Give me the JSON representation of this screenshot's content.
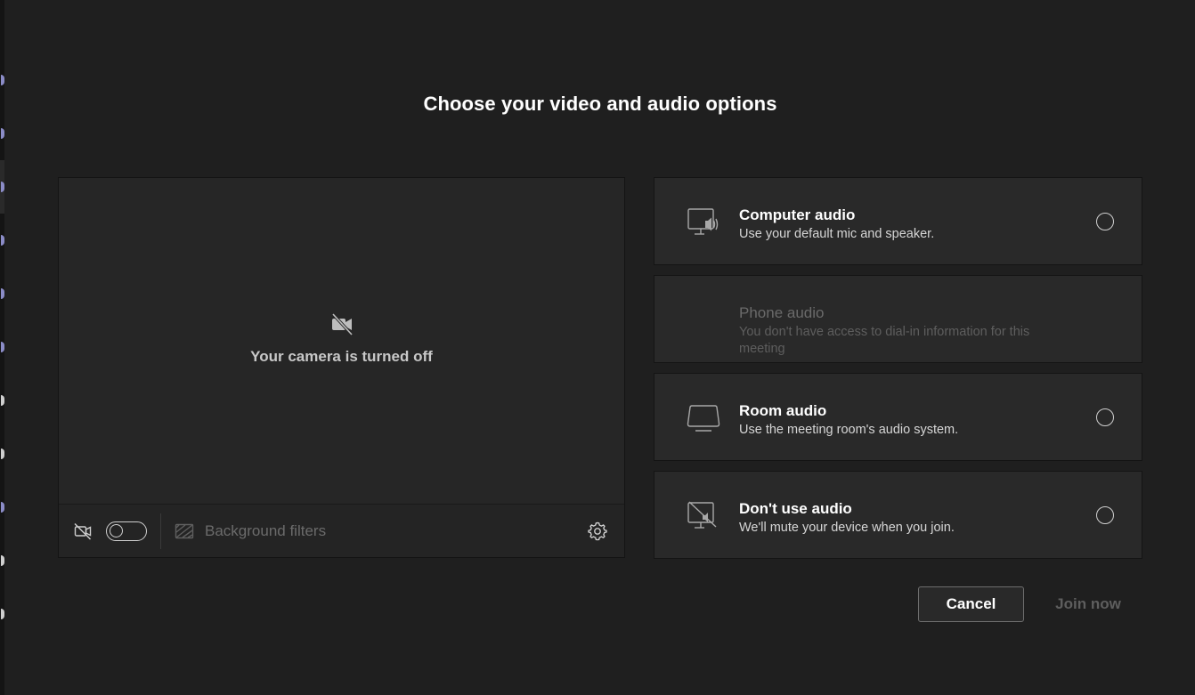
{
  "dialog": {
    "title": "Choose your video and audio options"
  },
  "preview": {
    "camera_off_text": "Your camera is turned off",
    "camera_toggle_state": "off",
    "background_filters_label": "Background filters",
    "icons": {
      "camera_off": "camera-off-icon",
      "background_filters": "background-filters-icon",
      "settings": "gear-icon"
    }
  },
  "audio_options": [
    {
      "title": "Computer audio",
      "description": "Use your default mic and speaker.",
      "icon": "computer-audio-icon",
      "enabled": true,
      "selected": false
    },
    {
      "title": "Phone audio",
      "description": "You don't have access to dial-in information for this meeting",
      "icon": "",
      "enabled": false,
      "selected": false
    },
    {
      "title": "Room audio",
      "description": "Use the meeting room's audio system.",
      "icon": "room-audio-icon",
      "enabled": true,
      "selected": false
    },
    {
      "title": "Don't use audio",
      "description": "We'll mute your device when you join.",
      "icon": "no-audio-icon",
      "enabled": true,
      "selected": false
    }
  ],
  "buttons": {
    "cancel_label": "Cancel",
    "join_label": "Join now"
  },
  "colors": {
    "background": "#1f1f1f",
    "panel": "#292929",
    "disabled_text": "#5e5e5e",
    "accent_strip": "#8b8cc7"
  }
}
